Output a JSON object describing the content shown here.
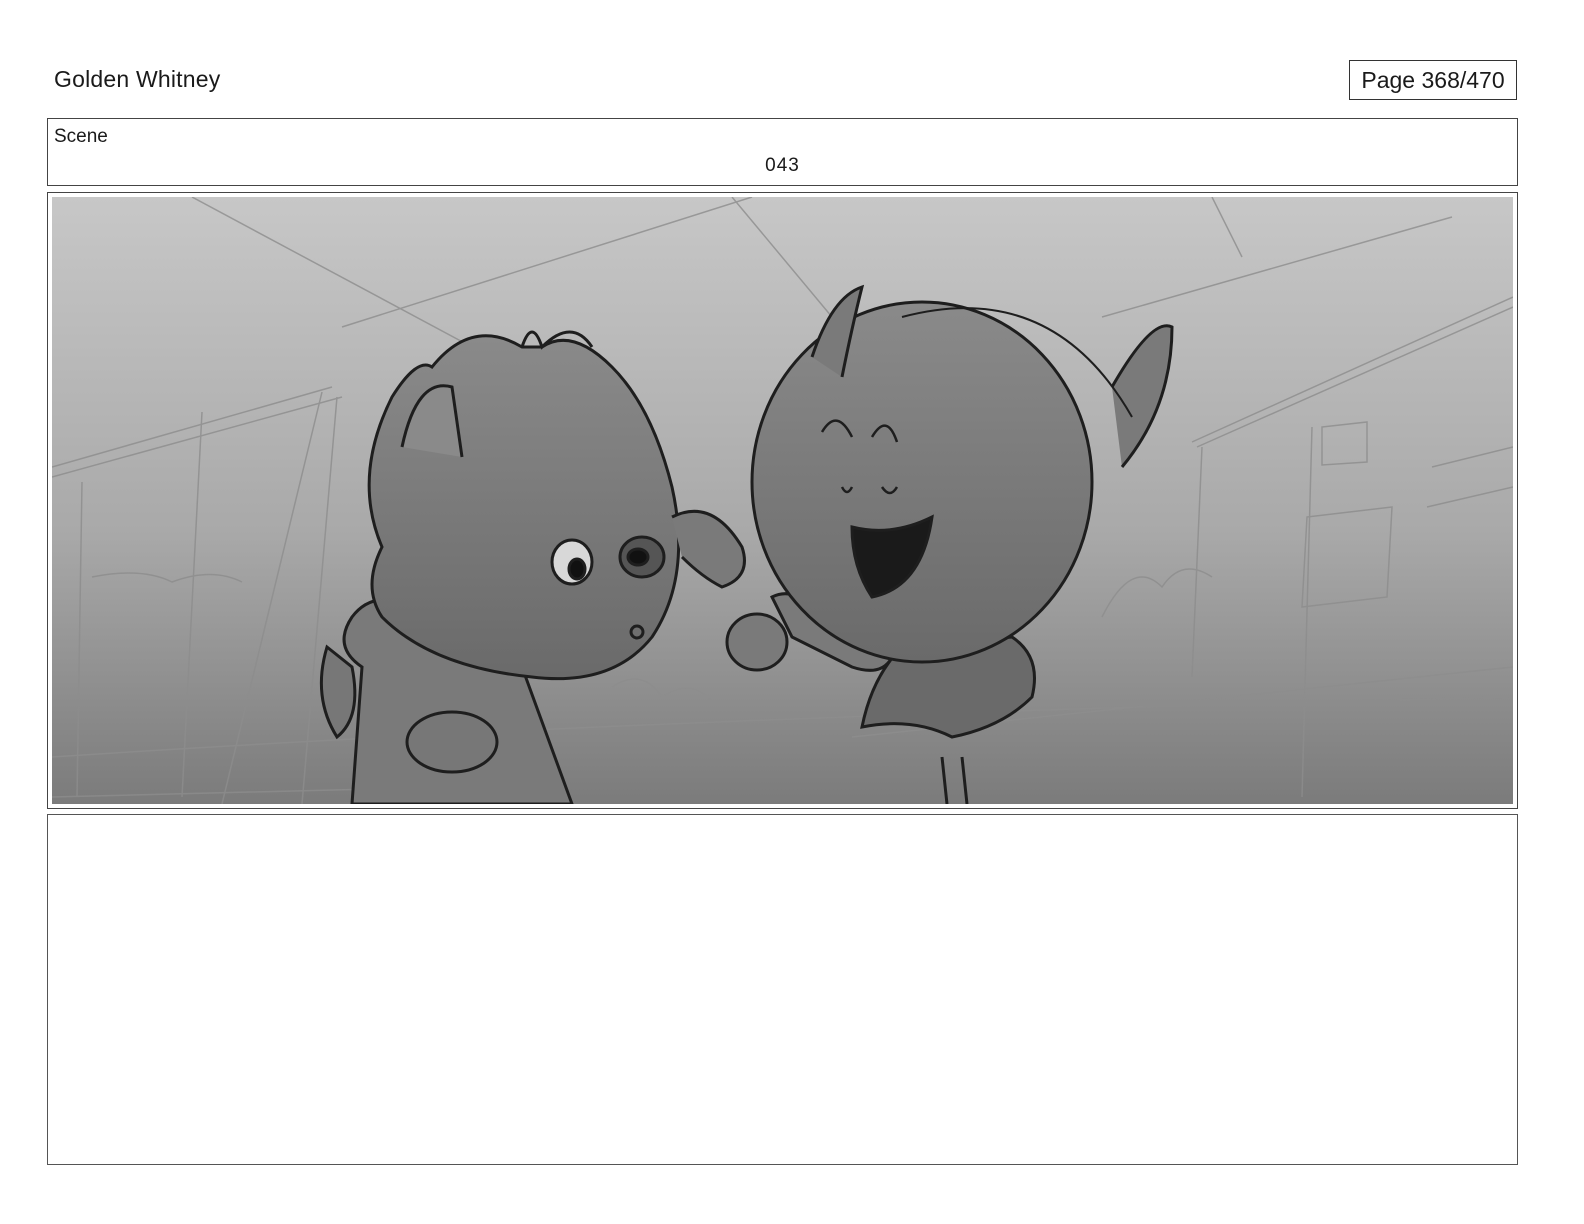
{
  "header": {
    "title": "Golden Whitney",
    "page_indicator": "Page 368/470"
  },
  "scene": {
    "label": "Scene",
    "number": "043"
  },
  "panel": {
    "illustration": "storyboard-sketch"
  },
  "notes": {
    "text": ""
  }
}
